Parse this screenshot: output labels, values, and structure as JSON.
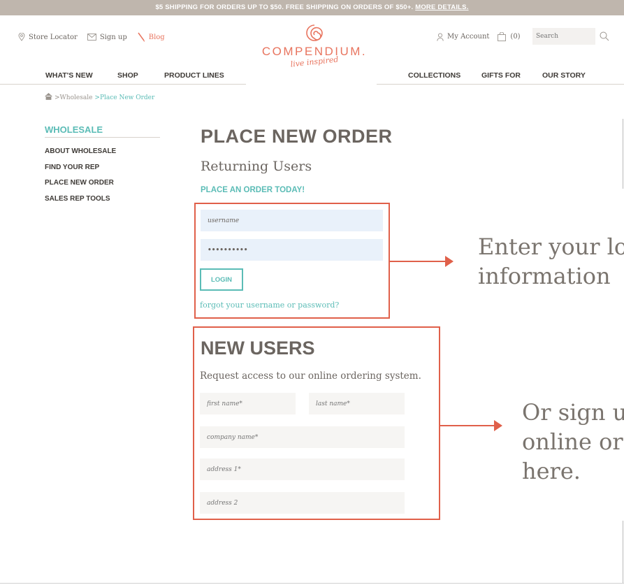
{
  "promo": {
    "text": "$5 SHIPPING FOR ORDERS UP TO $50. FREE SHIPPING ON ORDERS OF $50+. ",
    "link": "MORE DETAILS."
  },
  "utility": {
    "store_locator": "Store Locator",
    "sign_up": "Sign up",
    "blog": "Blog",
    "my_account": "My Account",
    "cart_count": "(0)",
    "search_placeholder": "Search"
  },
  "logo": {
    "wordmark": "COMPENDIUM.",
    "tagline": "live inspired"
  },
  "nav": {
    "whats_new": "WHAT'S NEW",
    "shop": "SHOP",
    "product_lines": "PRODUCT LINES",
    "collections": "COLLECTIONS",
    "gifts_for": "GIFTS FOR",
    "our_story": "OUR STORY"
  },
  "breadcrumb": {
    "wholesale": ">Wholesale",
    "current": ">Place New Order"
  },
  "sidebar": {
    "title": "WHOLESALE",
    "items": [
      "ABOUT WHOLESALE",
      "FIND YOUR REP",
      "PLACE NEW ORDER",
      "SALES REP TOOLS"
    ]
  },
  "main": {
    "title": "PLACE NEW ORDER",
    "subtitle": "Returning Users",
    "cta": "PLACE AN ORDER TODAY!",
    "username_value": "username",
    "password_value": "••••••••••",
    "login_label": "LOGIN",
    "forgot_link": "forgot your username or password?"
  },
  "new_users": {
    "title": "NEW USERS",
    "subtitle": "Request access to our online ordering system.",
    "first_name_placeholder": "first name*",
    "last_name_placeholder": "last name*",
    "company_placeholder": "company name*",
    "address1_placeholder": "address 1*",
    "address2_placeholder": "address 2"
  },
  "callouts": {
    "login_line1": "Enter your lo",
    "login_line2": "information",
    "signup_line1": "Or sign u",
    "signup_line2": "online or",
    "signup_line3": "here."
  },
  "colors": {
    "accent": "#5bbcb6",
    "brand": "#e8745e",
    "annotation": "#e0604a",
    "promo_bg": "#bfb6ad"
  }
}
